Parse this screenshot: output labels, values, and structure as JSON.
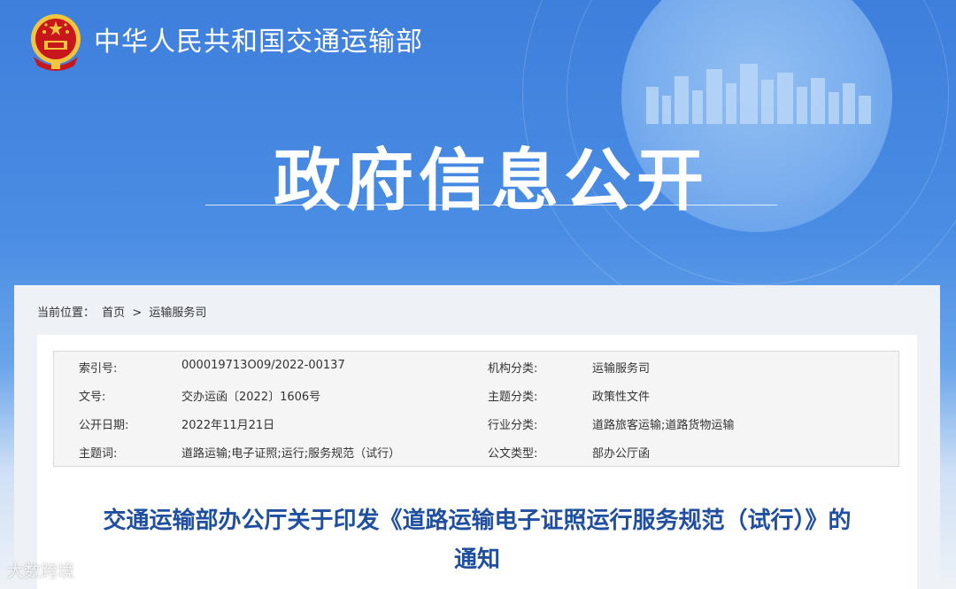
{
  "header": {
    "ministry": "中华人民共和国交通运输部",
    "banner_title": "政府信息公开"
  },
  "breadcrumb": {
    "label": "当前位置：",
    "home": "首页",
    "separator": ">",
    "current": "运输服务司"
  },
  "meta": {
    "rows": [
      {
        "left_label": "索引号:",
        "left_value": "000019713O09/2022-00137",
        "right_label": "机构分类:",
        "right_value": "运输服务司"
      },
      {
        "left_label": "文号:",
        "left_value": "交办运函〔2022〕1606号",
        "right_label": "主题分类:",
        "right_value": "政策性文件"
      },
      {
        "left_label": "公开日期:",
        "left_value": "2022年11月21日",
        "right_label": "行业分类:",
        "right_value": "道路旅客运输;道路货物运输"
      },
      {
        "left_label": "主题词:",
        "left_value": "道路运输;电子证照;运行;服务规范（试行）",
        "right_label": "公文类型:",
        "right_value": "部办公厅函"
      }
    ]
  },
  "document": {
    "title_line1": "交通运输部办公厅关于印发《道路运输电子证照运行服务规范（试行）》的",
    "title_line2": "通知"
  },
  "watermark": "大数跨境",
  "colors": {
    "banner_blue": "#3d7fdc",
    "title_blue": "#1f4f9e",
    "emblem_red": "#c8161d",
    "emblem_gold": "#f2c53d"
  }
}
